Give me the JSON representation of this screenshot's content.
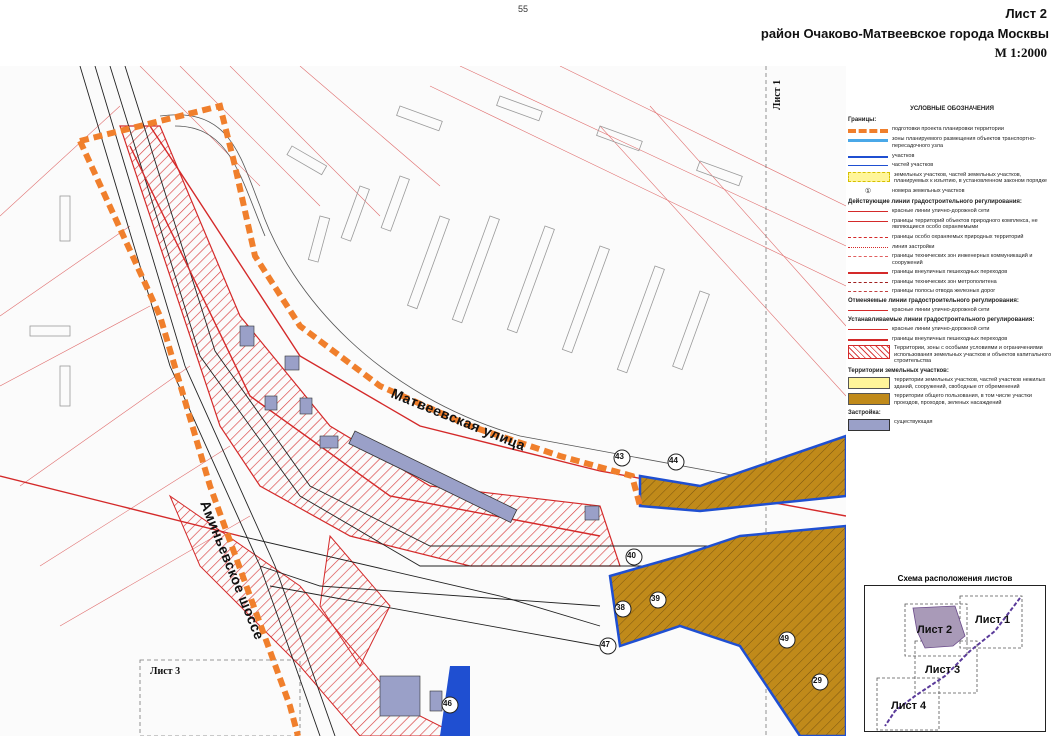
{
  "header": {
    "page_number": "55",
    "sheet": "Лист 2",
    "district": "район Очаково-Матвеевское города Москвы",
    "scale": "М 1:2000"
  },
  "map": {
    "street_1": "Матвеевская улица",
    "street_2": "Аминьевское шоссе",
    "sheet_ref_1": "Лист 1",
    "sheet_ref_3": "Лист 3",
    "parcels": [
      "43",
      "44",
      "40",
      "38",
      "39",
      "47",
      "49",
      "29",
      "46"
    ],
    "colors": {
      "boundary": "#f07f2c",
      "red_line": "#d42a2a",
      "parcel_blue": "#1f4fd1",
      "public": "#c08a1a",
      "hatch": "#d94040",
      "building": "#9aa0c8"
    }
  },
  "legend": {
    "title": "УСЛОВНЫЕ ОБОЗНАЧЕНИЯ",
    "sec_bounds": "Границы:",
    "b1": "подготовки проекта планировки территории",
    "b2": "зоны планируемого размещения объектов транспортно-пересадочного узла",
    "b3": "участков",
    "b4": "частей участков",
    "b5": "земельных участков, частей земельных участков, планируемых к изъятию, в установленном законом порядке",
    "b6": "номера земельных участков",
    "sec_active": "Действующие линии градостроительного регулирования:",
    "a1": "красные линии улично-дорожной сети",
    "a2": "границы территорий объектов природного комплекса, не являющиеся особо охраняемыми",
    "a3": "границы особо охраняемых природных территорий",
    "a4": "линия застройки",
    "a5": "границы технических зон инженерных коммуникаций и сооружений",
    "a6": "границы внеуличных пешеходных переходов",
    "a7": "границы технических зон метрополитена",
    "a8": "границы полосы отвода железных дорог",
    "sec_cancel": "Отменяемые линии градостроительного регулирования:",
    "c1": "красные линии улично-дорожной сети",
    "sec_set": "Устанавливаемые линии градостроительного регулирования:",
    "s1": "красные линии улично-дорожной сети",
    "s2": "границы внеуличных пешеходных переходов",
    "s3": "Территории, зоны с особыми условиями и ограничениями использования земельных участков и объектов капитального строительства",
    "sec_land": "Территории земельных участков:",
    "l1": "территории земельных участков, частей участков нежилых зданий, сооружений, свободные от обременений",
    "l2": "территории общего пользования, в том числе участки проездов, проходов, зеленых насаждений",
    "sec_build": "Застройка:",
    "bd1": "существующая"
  },
  "schema": {
    "title": "Схема расположения листов",
    "s1": "Лист 1",
    "s2": "Лист 2",
    "s3": "Лист 3",
    "s4": "Лист 4"
  }
}
